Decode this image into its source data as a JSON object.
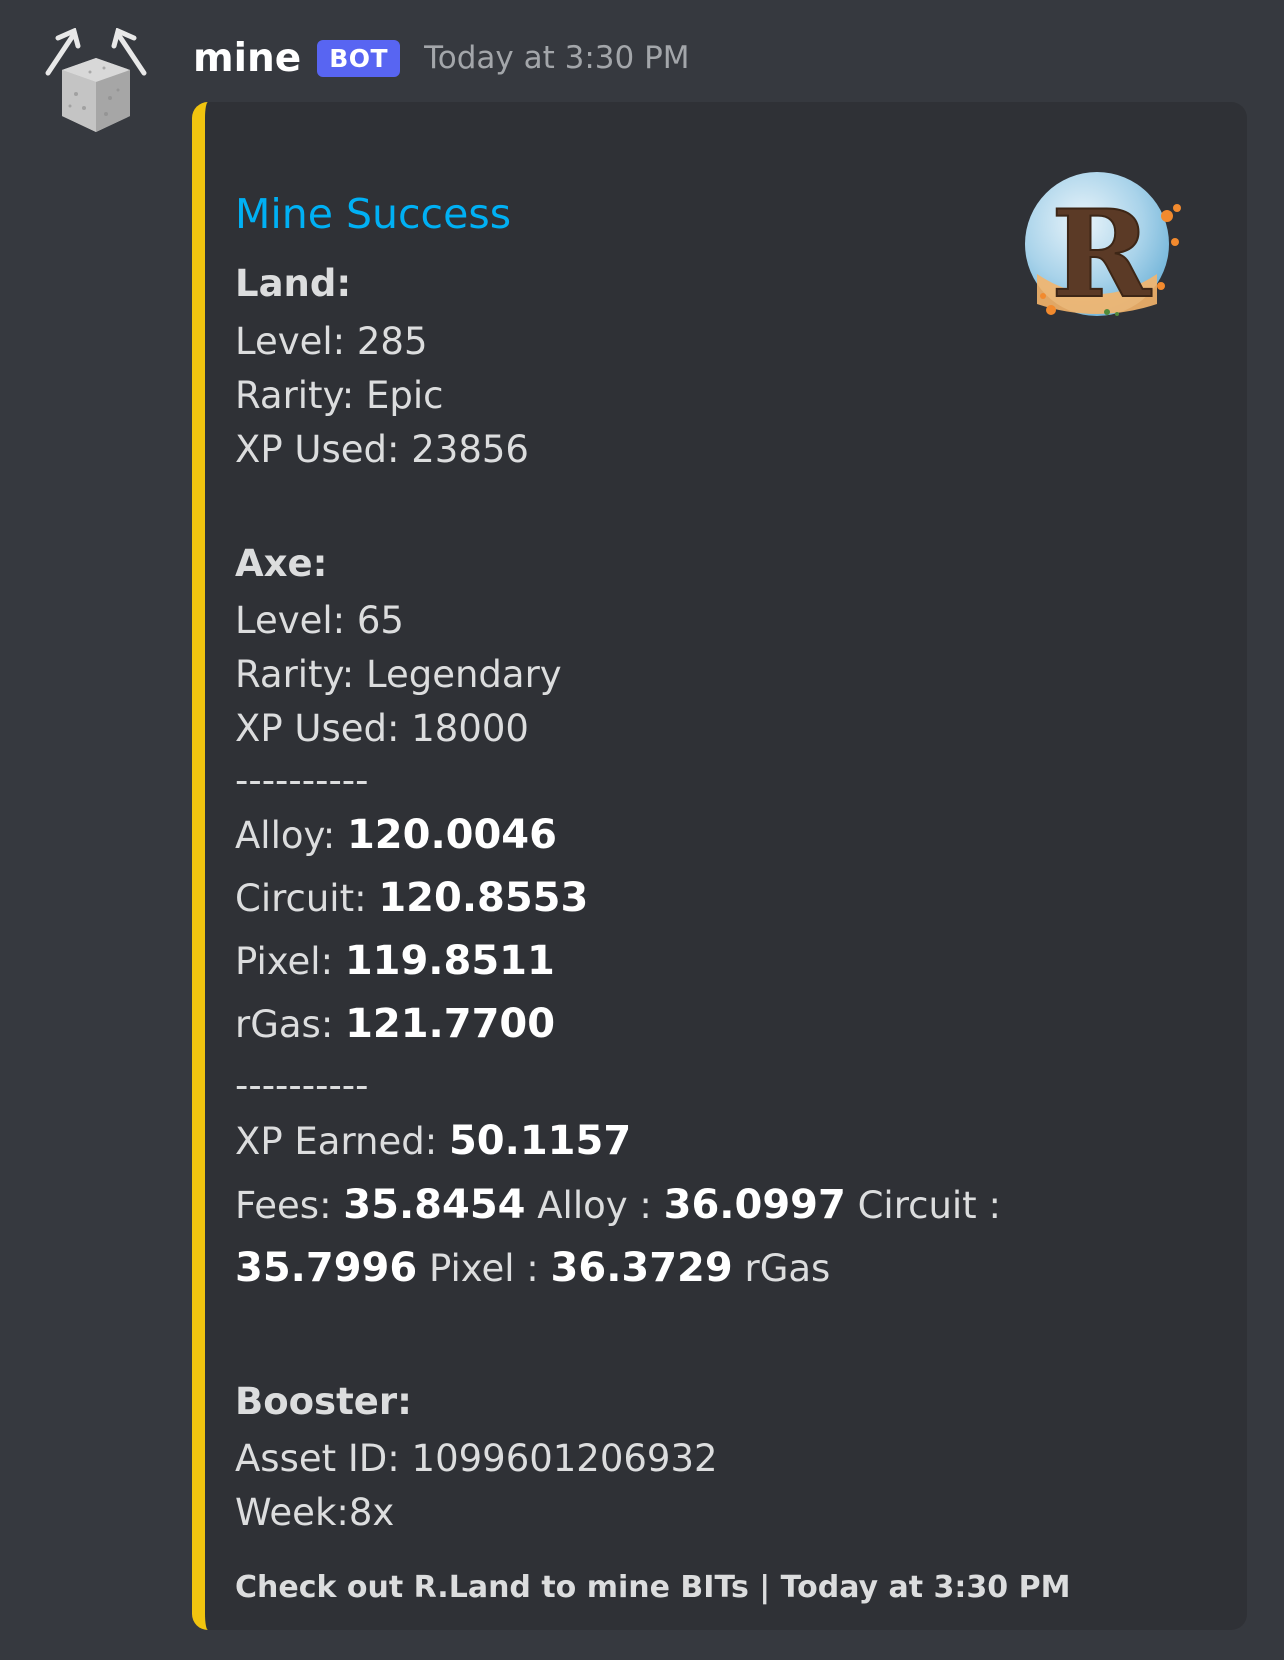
{
  "message": {
    "username": "mine",
    "badge": "BOT",
    "timestamp": "Today at 3:30 PM"
  },
  "embed": {
    "title": "Mine Success",
    "accent_color": "#f1c40f",
    "title_color": "#00b0f4",
    "thumbnail_letter": "R",
    "land": {
      "header": "Land:",
      "level": "Level: 285",
      "rarity": "Rarity: Epic",
      "xp_used": "XP Used: 23856"
    },
    "axe": {
      "header": "Axe:",
      "level": "Level: 65",
      "rarity": "Rarity: Legendary",
      "xp_used": "XP Used: 18000"
    },
    "divider": "----------",
    "resources": {
      "alloy_label": "Alloy: ",
      "alloy_value": "120.0046",
      "circuit_label": "Circuit: ",
      "circuit_value": "120.8553",
      "pixel_label": "Pixel: ",
      "pixel_value": "119.8511",
      "rgas_label": "rGas: ",
      "rgas_value": "121.7700"
    },
    "xp_earned_label": "XP Earned: ",
    "xp_earned_value": "50.1157",
    "fees": {
      "label": "Fees: ",
      "alloy_value": "35.8454",
      "alloy_unit": " Alloy : ",
      "circuit_value": "36.0997",
      "circuit_unit": " Circuit :",
      "pixel_value": "35.7996",
      "pixel_unit": " Pixel : ",
      "rgas_value": "36.3729",
      "rgas_unit": " rGas"
    },
    "booster": {
      "header": "Booster:",
      "asset_id": "Asset ID: 1099601206932",
      "week": "Week:8x"
    },
    "footer": "Check out R.Land to mine BITs | Today at 3:30 PM"
  }
}
